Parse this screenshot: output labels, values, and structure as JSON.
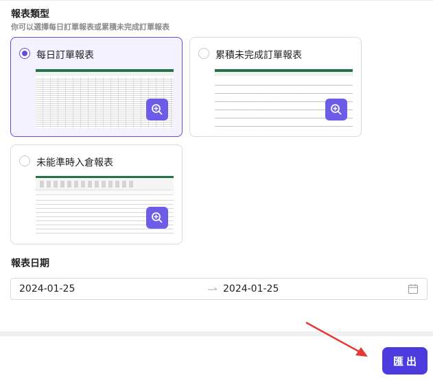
{
  "report_type": {
    "title": "報表類型",
    "subtitle": "你可以選擇每日訂單報表或累積未完成訂單報表",
    "options": [
      {
        "label": "每日訂單報表",
        "selected": true
      },
      {
        "label": "累積未完成訂單報表",
        "selected": false
      },
      {
        "label": "未能準時入倉報表",
        "selected": false
      }
    ],
    "preview_icon": "zoom-in-icon"
  },
  "report_date": {
    "title": "報表日期",
    "start": "2024-01-25",
    "end": "2024-01-25",
    "separator_icon": "arrow-right-icon",
    "calendar_icon": "calendar-icon"
  },
  "footer": {
    "export_label": "匯出"
  },
  "colors": {
    "accent": "#5b4ae6",
    "button": "#4d3bdf",
    "annotation_arrow": "#e53935"
  }
}
